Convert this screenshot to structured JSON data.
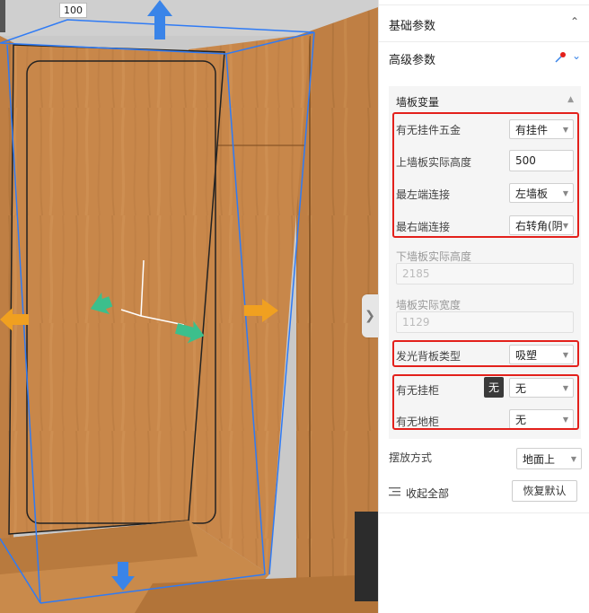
{
  "viewport": {
    "dimension_label": "100",
    "expand_icon": "chevron-right-icon"
  },
  "panel": {
    "basic_section": {
      "title": "基础参数",
      "icon": "chevron-up-icon"
    },
    "advanced_section": {
      "title": "高级参数",
      "icons": [
        "pin-icon",
        "chevron-down-icon"
      ]
    },
    "group": {
      "title": "墙板变量",
      "icon": "caret-up-icon",
      "fields": {
        "hardware": {
          "label": "有无挂件五金",
          "value": "有挂件"
        },
        "upper_height": {
          "label": "上墙板实际高度",
          "value": "500"
        },
        "left_connect": {
          "label": "最左端连接",
          "value": "左墙板"
        },
        "right_connect": {
          "label": "最右端连接",
          "value": "右转角(阴"
        },
        "lower_height": {
          "label": "下墙板实际高度",
          "value": "2185"
        },
        "panel_width": {
          "label": "墙板实际宽度",
          "value": "1129"
        },
        "backlight": {
          "label": "发光背板类型",
          "value": "吸塑"
        },
        "hanging_cabinet": {
          "label": "有无挂柜",
          "value": "无"
        },
        "floor_cabinet": {
          "label": "有无地柜",
          "value": "无"
        }
      },
      "tooltip": "无"
    },
    "placement": {
      "label": "摆放方式",
      "value": "地面上"
    },
    "collapse_all": {
      "label": "收起全部",
      "icon": "collapse-list-icon"
    },
    "reset_button": "恢复默认"
  },
  "colors": {
    "highlight_box": "#e3201b",
    "selection_outline": "#2f7bf5",
    "wood": "#c98a4b",
    "arrow_blue": "#3a84e8",
    "arrow_orange": "#f0a020",
    "arrow_green": "#3cbf8c"
  }
}
